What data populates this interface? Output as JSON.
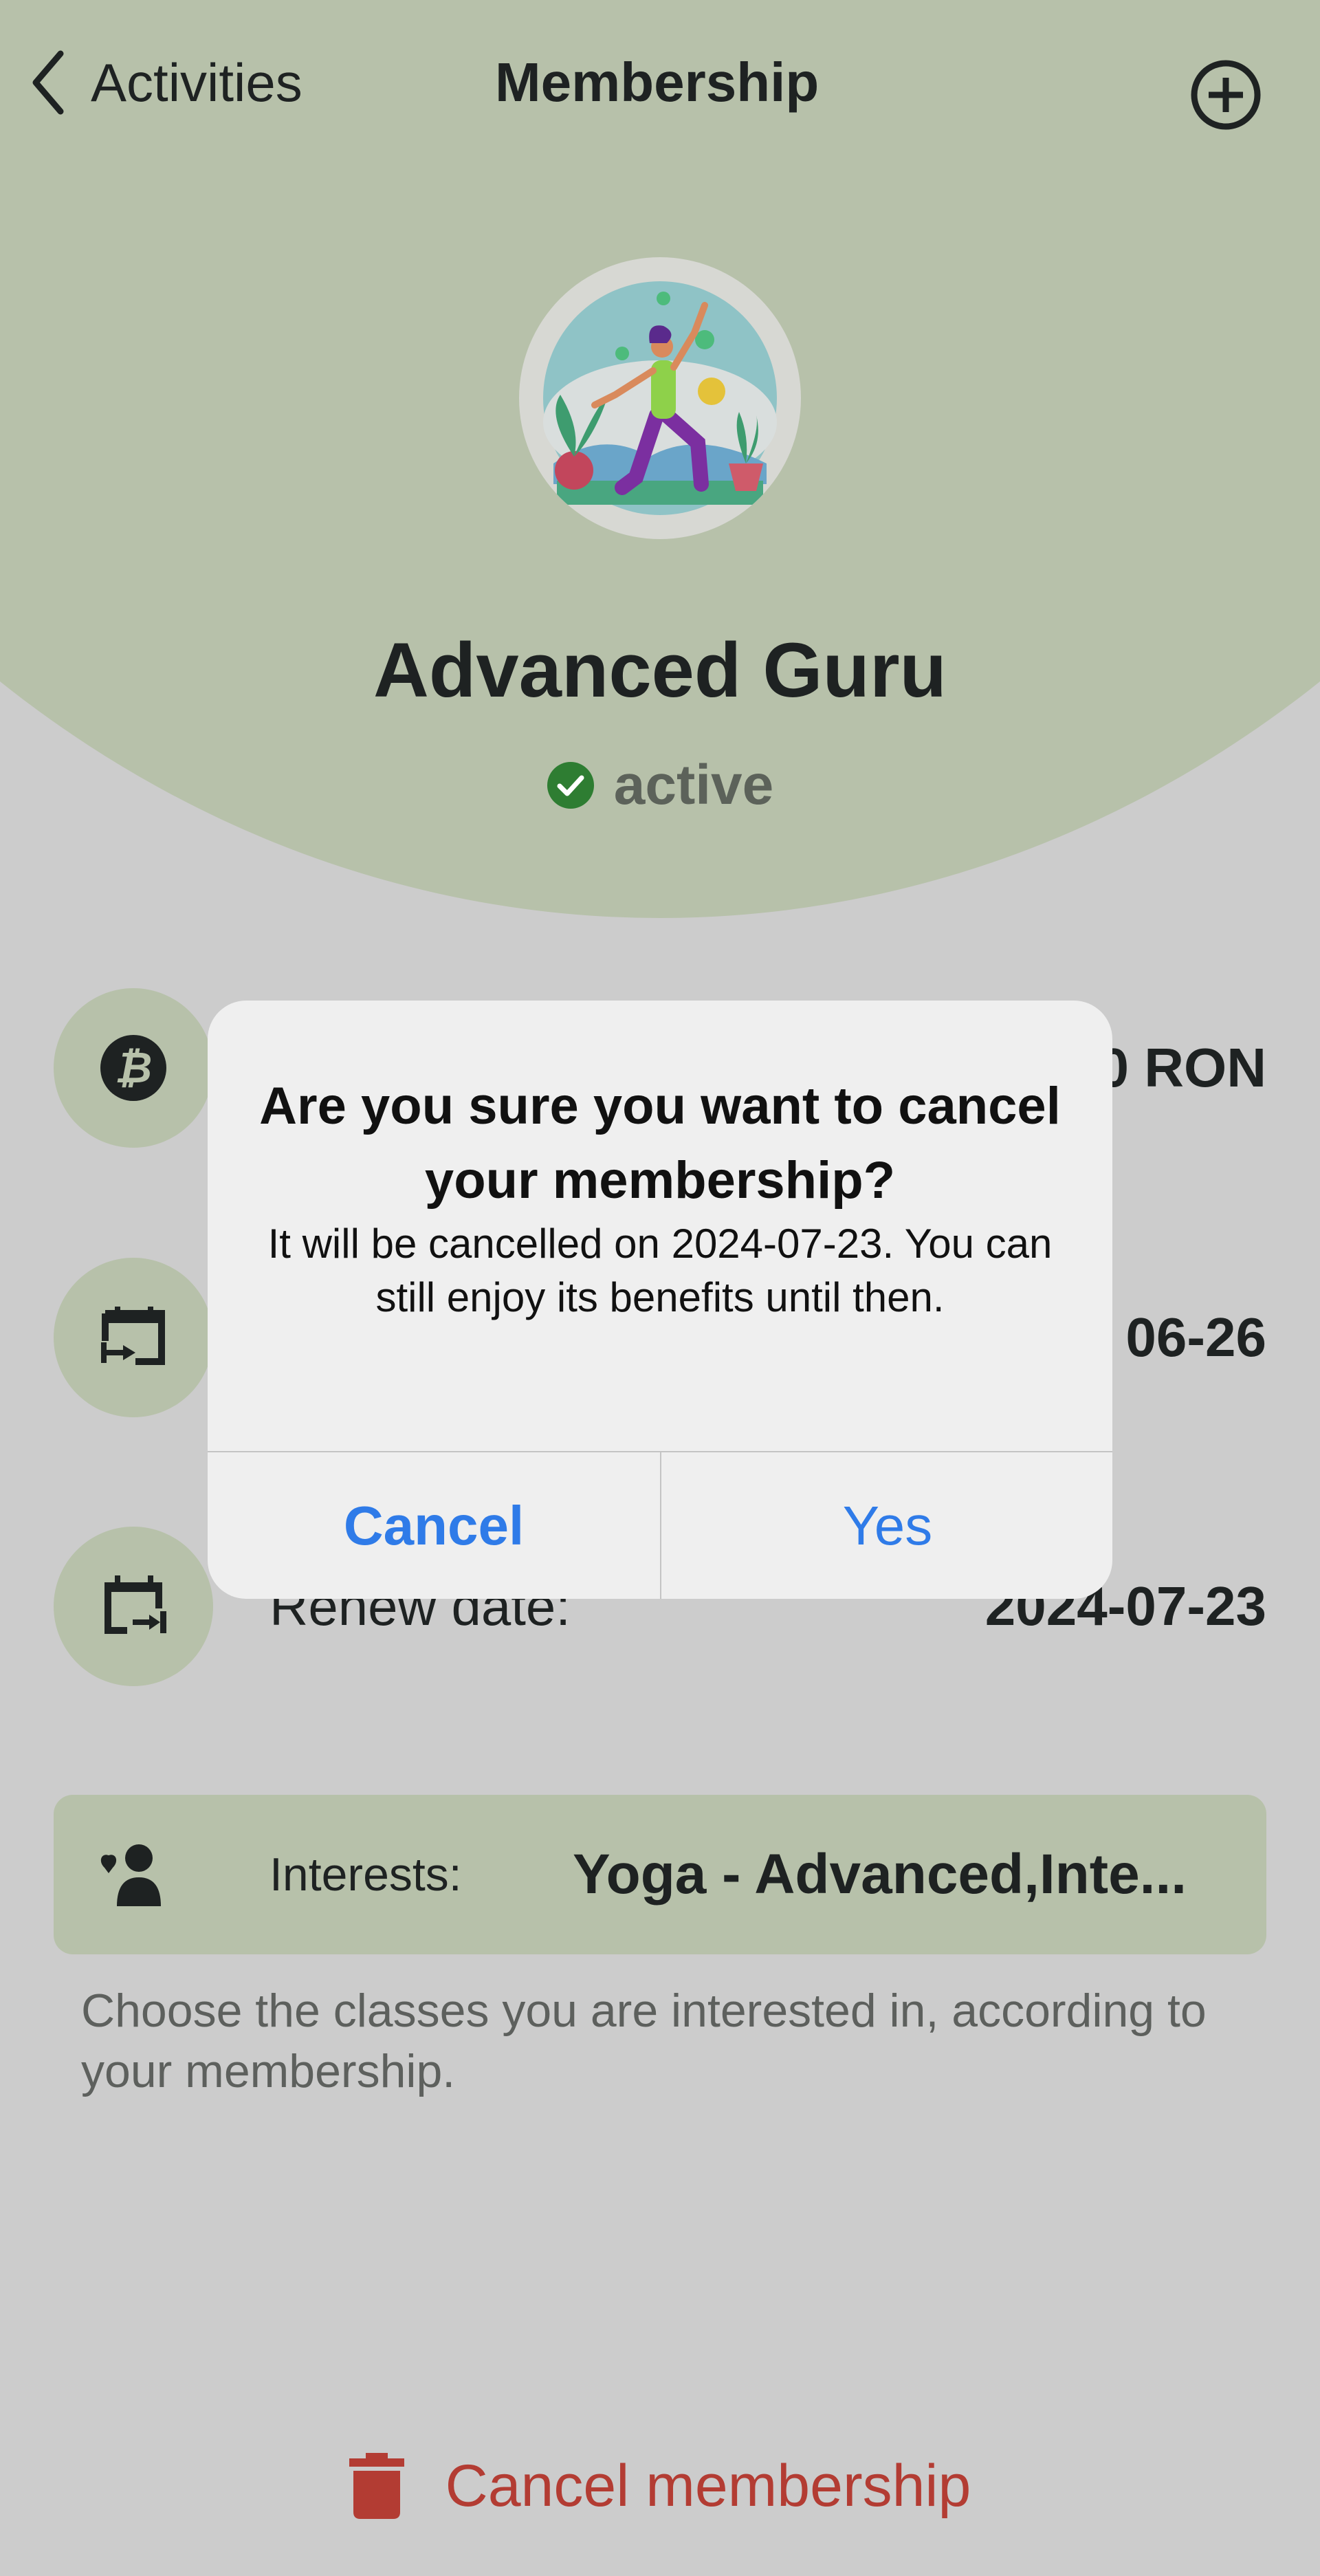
{
  "nav": {
    "back_label": "Activities",
    "title": "Membership"
  },
  "membership": {
    "name": "Advanced Guru",
    "status": "active",
    "status_color": "#2e7d32"
  },
  "details": [
    {
      "icon": "bitcoin-icon",
      "label": "",
      "value": "0 RON"
    },
    {
      "icon": "calendar-start-icon",
      "label": "",
      "value": "06-26"
    },
    {
      "icon": "calendar-end-icon",
      "label": "Renew date:",
      "value": "2024-07-23"
    }
  ],
  "interests": {
    "label": "Interests:",
    "value": "Yoga - Advanced,Inte...",
    "hint": "Choose the classes you are interested in, according to your membership."
  },
  "cancel_membership_label": "Cancel membership",
  "dialog": {
    "title": "Are you sure you want to cancel your membership?",
    "message": "It will be cancelled on 2024-07-23. You can still enjoy its benefits until then.",
    "cancel_label": "Cancel",
    "confirm_label": "Yes"
  },
  "colors": {
    "accent": "#b7c1aa",
    "danger": "#b33c33",
    "link": "#2f7be8"
  }
}
